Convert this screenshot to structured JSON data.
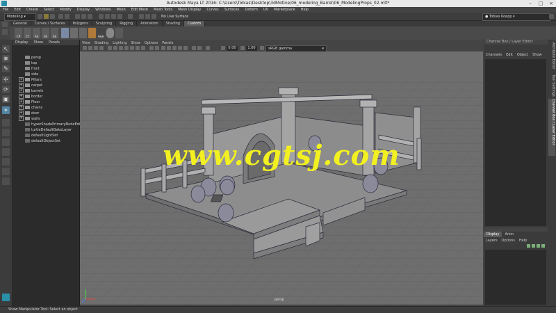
{
  "window": {
    "title": "Autodesk Maya LT 2016: C:\\Users\\Tobias\\Desktop\\3dMotive\\06_modeling_Barrel\\06_ModelingProps_02.mlt*"
  },
  "menubar": [
    "File",
    "Edit",
    "Create",
    "Select",
    "Modify",
    "Display",
    "Windows",
    "Mesh",
    "Edit Mesh",
    "Mesh Tools",
    "Mesh Display",
    "Curves",
    "Surfaces",
    "Deform",
    "UV",
    "Marketplace",
    "Help"
  ],
  "statusline": {
    "mode": "Modeling",
    "live_surface": "No Live Surface",
    "user": "Tobias Koepp"
  },
  "shelf": {
    "tabs": [
      "General",
      "Curves / Surfaces",
      "Polygons",
      "Sculpting",
      "Rigging",
      "Animation",
      "Shading",
      "Custom"
    ],
    "active_tab": "Custom",
    "buttons": [
      "CP",
      "CT",
      "AS",
      "SS",
      "SS",
      "",
      "",
      "",
      "",
      "H&H"
    ]
  },
  "outliner": {
    "menu": [
      "Display",
      "Show",
      "Panels"
    ],
    "items": [
      {
        "label": "persp",
        "type": "camera",
        "expandable": false
      },
      {
        "label": "top",
        "type": "camera",
        "expandable": false
      },
      {
        "label": "front",
        "type": "camera",
        "expandable": false
      },
      {
        "label": "side",
        "type": "camera",
        "expandable": false
      },
      {
        "label": "Pillars",
        "type": "group",
        "expandable": true
      },
      {
        "label": "carpet",
        "type": "group",
        "expandable": true
      },
      {
        "label": "barrels",
        "type": "group",
        "expandable": true
      },
      {
        "label": "border",
        "type": "group",
        "expandable": true
      },
      {
        "label": "Floor",
        "type": "group",
        "expandable": true
      },
      {
        "label": "chains",
        "type": "group",
        "expandable": true
      },
      {
        "label": "door",
        "type": "group",
        "expandable": true
      },
      {
        "label": "walls",
        "type": "group",
        "expandable": true
      },
      {
        "label": "hyperShadePrimaryNodeEditorSavedTabsInfo",
        "type": "set",
        "expandable": false
      },
      {
        "label": "turtleDefaultBakeLayer",
        "type": "set",
        "expandable": false
      },
      {
        "label": "defaultLightSet",
        "type": "set",
        "expandable": false
      },
      {
        "label": "defaultObjectSet",
        "type": "set",
        "expandable": false
      }
    ]
  },
  "viewport": {
    "menu": [
      "View",
      "Shading",
      "Lighting",
      "Show",
      "Options",
      "Panels"
    ],
    "field_a": "0.00",
    "field_b": "1.00",
    "color_space": "sRGB gamma",
    "camera_label": "persp",
    "watermark": "www.cgtsj.com"
  },
  "channelbox": {
    "header": "Channel Box / Layer Editor",
    "menu": [
      "Channels",
      "Edit",
      "Object",
      "Show"
    ]
  },
  "side_tabs": [
    "Attribute Editor",
    "Tool Settings",
    "Channel Box / Layer Editor"
  ],
  "layereditor": {
    "tabs": [
      "Display",
      "Anim"
    ],
    "active_tab": "Display",
    "menu": [
      "Layers",
      "Options",
      "Help"
    ]
  },
  "helpline": {
    "text": "Show Manipulator Tool: Select an object"
  },
  "colors": {
    "accent": "#5285a6",
    "watermark": "#f2f021",
    "viewport_bg": "#6e6e6e"
  }
}
